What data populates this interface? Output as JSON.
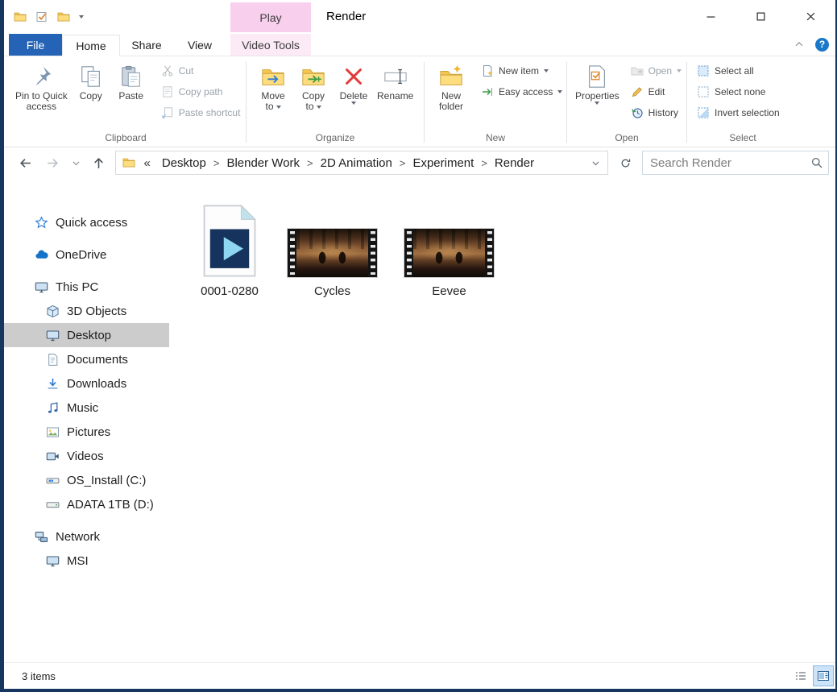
{
  "window": {
    "title": "Render"
  },
  "contextual": {
    "header": "Play",
    "tab": "Video Tools"
  },
  "tabs": {
    "file": "File",
    "home": "Home",
    "share": "Share",
    "view": "View"
  },
  "misc": {
    "help": "?"
  },
  "ribbon": {
    "clipboard": {
      "label": "Clipboard",
      "pin_line1": "Pin to Quick",
      "pin_line2": "access",
      "copy": "Copy",
      "paste": "Paste",
      "cut": "Cut",
      "copy_path": "Copy path",
      "paste_shortcut": "Paste shortcut"
    },
    "organize": {
      "label": "Organize",
      "move_line1": "Move",
      "move_line2": "to",
      "copyto_line1": "Copy",
      "copyto_line2": "to",
      "delete": "Delete",
      "rename": "Rename"
    },
    "new": {
      "label": "New",
      "newfolder_line1": "New",
      "newfolder_line2": "folder",
      "new_item": "New item",
      "easy_access": "Easy access"
    },
    "open": {
      "label": "Open",
      "properties": "Properties",
      "open": "Open",
      "edit": "Edit",
      "history": "History"
    },
    "select": {
      "label": "Select",
      "select_all": "Select all",
      "select_none": "Select none",
      "invert": "Invert selection"
    }
  },
  "addressbar": {
    "overflow": "«",
    "separator": ">",
    "crumbs": [
      "Desktop",
      "Blender Work",
      "2D Animation",
      "Experiment",
      "Render"
    ],
    "search_placeholder": "Search Render"
  },
  "sidebar": {
    "items": [
      {
        "label": "Quick access"
      },
      {
        "label": "OneDrive"
      },
      {
        "label": "This PC"
      },
      {
        "label": "3D Objects"
      },
      {
        "label": "Desktop"
      },
      {
        "label": "Documents"
      },
      {
        "label": "Downloads"
      },
      {
        "label": "Music"
      },
      {
        "label": "Pictures"
      },
      {
        "label": "Videos"
      },
      {
        "label": "OS_Install (C:)"
      },
      {
        "label": "ADATA 1TB (D:)"
      },
      {
        "label": "Network"
      },
      {
        "label": "MSI"
      }
    ]
  },
  "files": [
    {
      "name": "0001-0280"
    },
    {
      "name": "Cycles"
    },
    {
      "name": "Eevee"
    }
  ],
  "statusbar": {
    "count": "3 items"
  }
}
